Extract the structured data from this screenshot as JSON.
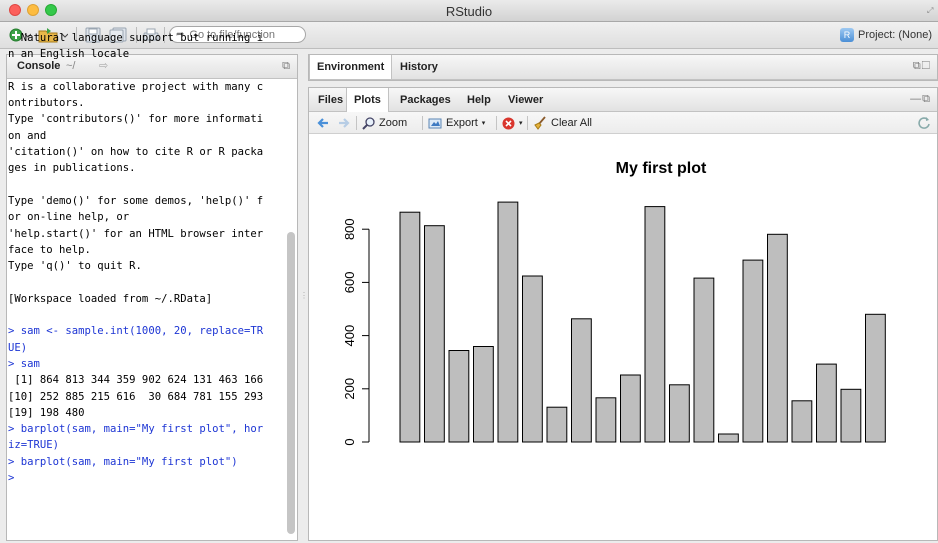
{
  "window": {
    "title": "RStudio"
  },
  "toolbar": {
    "goto_placeholder": "Go to file/function",
    "project_label": "Project: (None)"
  },
  "console": {
    "title": "Console",
    "path": "~/",
    "lines": [
      {
        "text": "  Natural language support but running i",
        "type": "out"
      },
      {
        "text": "n an English locale",
        "type": "out"
      },
      {
        "text": "",
        "type": "out"
      },
      {
        "text": "R is a collaborative project with many c",
        "type": "out"
      },
      {
        "text": "ontributors.",
        "type": "out"
      },
      {
        "text": "Type 'contributors()' for more informati",
        "type": "out"
      },
      {
        "text": "on and",
        "type": "out"
      },
      {
        "text": "'citation()' on how to cite R or R packa",
        "type": "out"
      },
      {
        "text": "ges in publications.",
        "type": "out"
      },
      {
        "text": "",
        "type": "out"
      },
      {
        "text": "Type 'demo()' for some demos, 'help()' f",
        "type": "out"
      },
      {
        "text": "or on-line help, or",
        "type": "out"
      },
      {
        "text": "'help.start()' for an HTML browser inter",
        "type": "out"
      },
      {
        "text": "face to help.",
        "type": "out"
      },
      {
        "text": "Type 'q()' to quit R.",
        "type": "out"
      },
      {
        "text": "",
        "type": "out"
      },
      {
        "text": "[Workspace loaded from ~/.RData]",
        "type": "out"
      },
      {
        "text": "",
        "type": "out"
      },
      {
        "text": "> sam <- sample.int(1000, 20, replace=TR",
        "type": "cmd"
      },
      {
        "text": "UE)",
        "type": "cmd"
      },
      {
        "text": "> sam",
        "type": "cmd"
      },
      {
        "text": " [1] 864 813 344 359 902 624 131 463 166",
        "type": "out"
      },
      {
        "text": "[10] 252 885 215 616  30 684 781 155 293",
        "type": "out"
      },
      {
        "text": "[19] 198 480",
        "type": "out"
      },
      {
        "text": "> barplot(sam, main=\"My first plot\", hor",
        "type": "cmd"
      },
      {
        "text": "iz=TRUE)",
        "type": "cmd"
      },
      {
        "text": "> barplot(sam, main=\"My first plot\")",
        "type": "cmd"
      },
      {
        "text": ">",
        "type": "prompt"
      }
    ]
  },
  "top_right_pane": {
    "tabs": [
      "Environment",
      "History"
    ]
  },
  "bottom_right_pane": {
    "tabs": [
      "Files",
      "Plots",
      "Packages",
      "Help",
      "Viewer"
    ],
    "active_tab": "Plots",
    "toolbar": {
      "zoom_label": "Zoom",
      "export_label": "Export",
      "clear_all_label": "Clear All"
    }
  },
  "chart_data": {
    "type": "bar",
    "title": "My first plot",
    "xlabel": "",
    "ylabel": "",
    "values": [
      864,
      813,
      344,
      359,
      902,
      624,
      131,
      463,
      166,
      252,
      885,
      215,
      616,
      30,
      684,
      781,
      155,
      293,
      198,
      480
    ],
    "ylim": [
      0,
      902
    ],
    "yticks": [
      0,
      200,
      400,
      600,
      800
    ],
    "bar_color": "#bebebe",
    "grid": false
  },
  "colors": {
    "command_text": "#1d35d4",
    "bar_fill": "#bebebe"
  }
}
